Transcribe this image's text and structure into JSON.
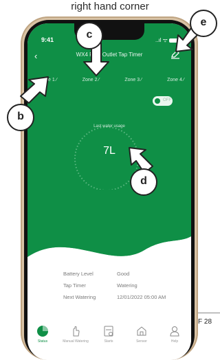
{
  "caption": "right hand corner",
  "page_ref": "F 28",
  "status_bar": {
    "time": "9:41",
    "signal_icons": "..ıl ᯤ"
  },
  "header": {
    "title": "WX4 Four Outlet Tap Timer"
  },
  "tabs": [
    {
      "label": "Zone 1 ⁄"
    },
    {
      "label": "Zone 2 ⁄"
    },
    {
      "label": "Zone 3 ⁄"
    },
    {
      "label": "Zone 4 ⁄"
    }
  ],
  "toggle": {
    "state": "off",
    "text": "OFF"
  },
  "usage": {
    "label": "Last water usage",
    "value": "7L"
  },
  "info": [
    {
      "label": "Battery Level",
      "value": "Good"
    },
    {
      "label": "Tap Timer",
      "value": "Watering"
    },
    {
      "label": "Next Watering",
      "value": "12/01/2022 05:00 AM"
    }
  ],
  "nav": [
    {
      "label": "Status",
      "icon": "status-icon",
      "active": true
    },
    {
      "label": "Manual Watering",
      "icon": "hand-icon",
      "active": false
    },
    {
      "label": "Starts",
      "icon": "schedule-icon",
      "active": false
    },
    {
      "label": "Sensor",
      "icon": "sensor-icon",
      "active": false
    },
    {
      "label": "Help",
      "icon": "help-icon",
      "active": false
    }
  ],
  "callouts": {
    "b": "b",
    "c": "c",
    "d": "d",
    "e": "e"
  },
  "colors": {
    "brand_green": "#0f8f46",
    "white": "#ffffff"
  }
}
